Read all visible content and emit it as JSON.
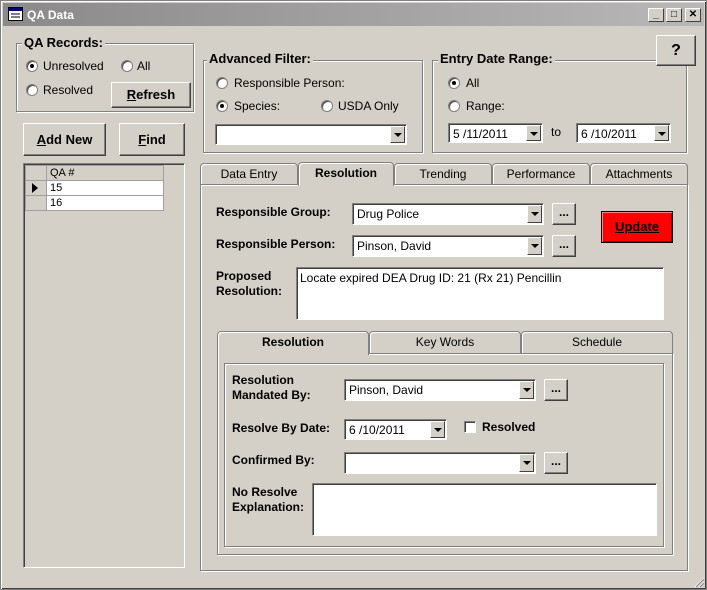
{
  "window": {
    "title": "QA Data",
    "minimize": "_",
    "maximize": "□",
    "close": "✕"
  },
  "help_button": "?",
  "qa_records": {
    "title": "QA Records:",
    "unresolved": "Unresolved",
    "all": "All",
    "resolved": "Resolved",
    "selected": "Unresolved",
    "refresh": "Refresh",
    "add_new": "Add New",
    "find": "Find"
  },
  "qa_grid": {
    "header": "QA #",
    "rows": [
      "15",
      "16"
    ],
    "selected_index": 0
  },
  "advanced_filter": {
    "title": "Advanced Filter:",
    "responsible_person": "Responsible Person:",
    "species": "Species:",
    "usda_only": "USDA Only",
    "selected": "Species:",
    "combo_value": ""
  },
  "entry_date_range": {
    "title": "Entry Date Range:",
    "all": "All",
    "range": "Range:",
    "selected": "All",
    "from": "5 /11/2011",
    "to_label": "to",
    "to": "6 /10/2011"
  },
  "main_tabs": [
    "Data Entry",
    "Resolution",
    "Trending",
    "Performance",
    "Attachments"
  ],
  "main_active_tab": "Resolution",
  "resolution": {
    "responsible_group_label": "Responsible Group:",
    "responsible_group": "Drug Police",
    "responsible_person_label": "Responsible Person:",
    "responsible_person": "Pinson, David",
    "proposed_resolution_label_1": "Proposed",
    "proposed_resolution_label_2": "Resolution:",
    "proposed_resolution": "Locate expired DEA Drug ID: 21 (Rx 21) Pencillin",
    "update_button": "Update",
    "update_color": "#ff0000",
    "browse": "..."
  },
  "sub_tabs": [
    "Resolution",
    "Key Words",
    "Schedule"
  ],
  "sub_active_tab": "Resolution",
  "sub_resolution": {
    "mandated_label_1": "Resolution",
    "mandated_label_2": "Mandated By:",
    "mandated_by": "Pinson, David",
    "resolve_by_label": "Resolve By Date:",
    "resolve_by": "6 /10/2011",
    "resolved_label": "Resolved",
    "resolved_checked": false,
    "confirmed_by_label": "Confirmed By:",
    "confirmed_by": "",
    "no_resolve_label_1": "No Resolve",
    "no_resolve_label_2": "Explanation:",
    "no_resolve_text": ""
  }
}
